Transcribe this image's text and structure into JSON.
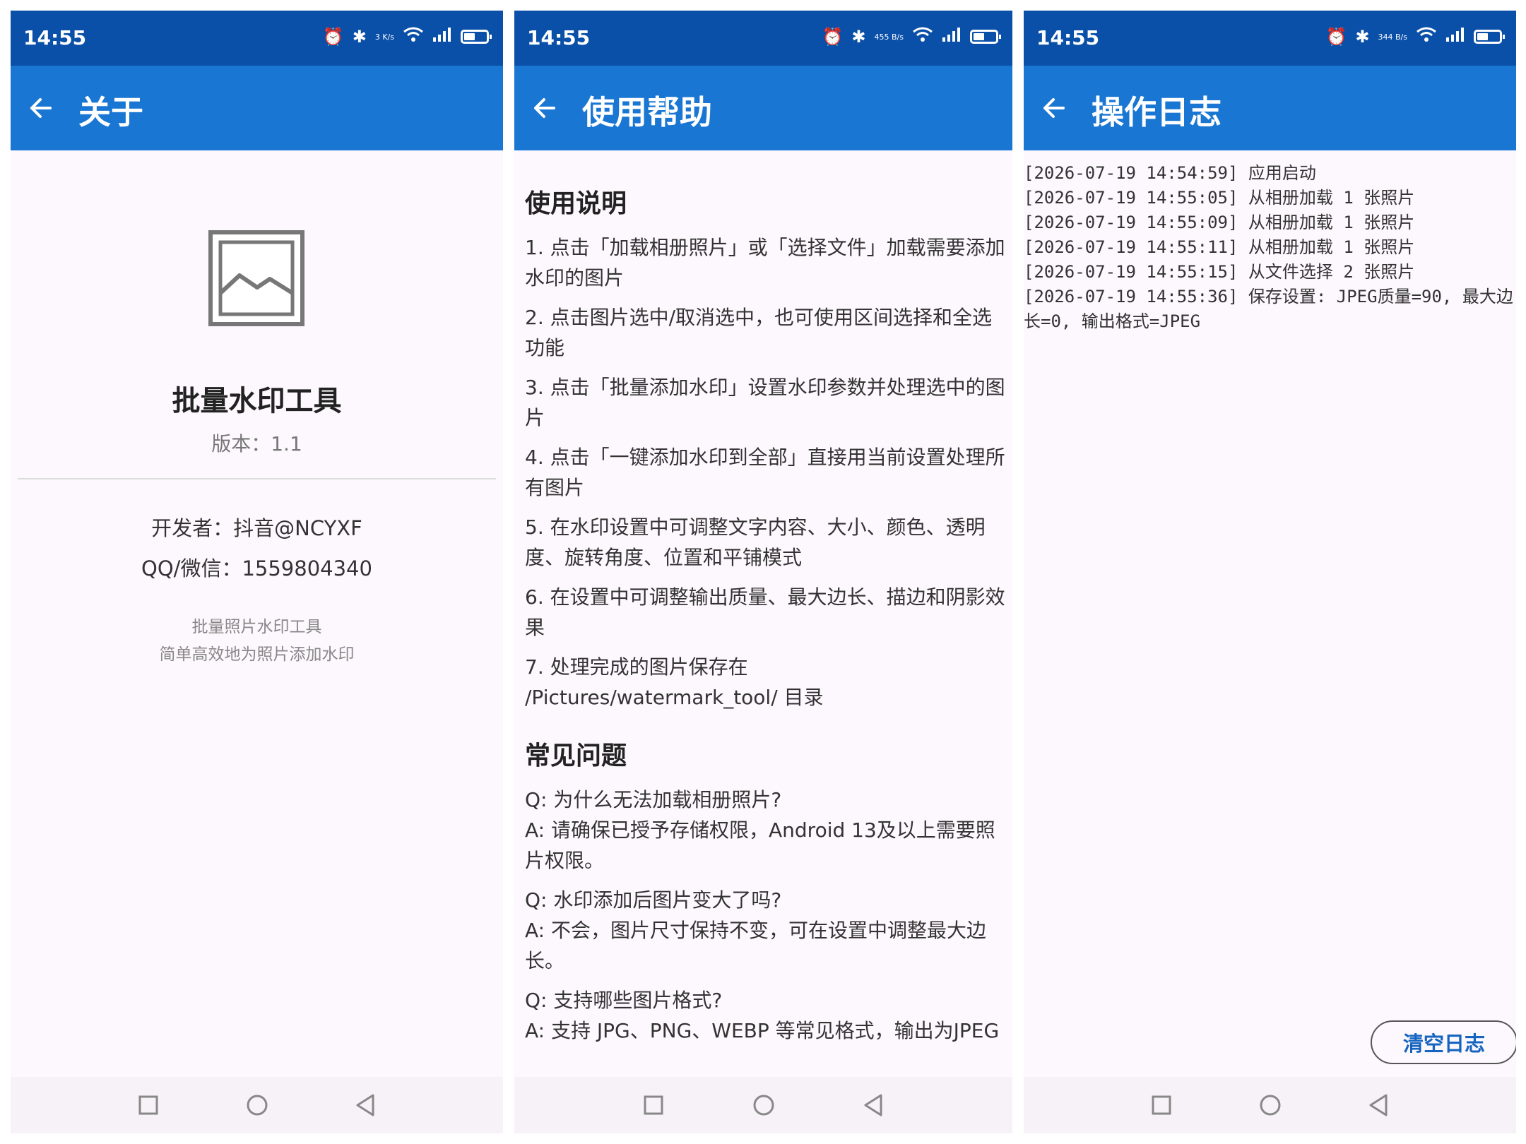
{
  "status": {
    "time": "14:55",
    "net_speeds": [
      "3 K/s",
      "455 B/s",
      "344 B/s"
    ]
  },
  "screen_about": {
    "title": "关于",
    "app_name": "批量水印工具",
    "version": "版本：1.1",
    "developer": "开发者：抖音@NCYXF",
    "contact": "QQ/微信：1559804340",
    "desc_line1": "批量照片水印工具",
    "desc_line2": "简单高效地为照片添加水印"
  },
  "screen_help": {
    "title": "使用帮助",
    "usage_heading": "使用说明",
    "usage": [
      "1. 点击「加载相册照片」或「选择文件」加载需要添加水印的图片",
      "2. 点击图片选中/取消选中，也可使用区间选择和全选功能",
      "3. 点击「批量添加水印」设置水印参数并处理选中的图片",
      "4. 点击「一键添加水印到全部」直接用当前设置处理所有图片",
      "5. 在水印设置中可调整文字内容、大小、颜色、透明度、旋转角度、位置和平铺模式",
      "6. 在设置中可调整输出质量、最大边长、描边和阴影效果",
      "7. 处理完成的图片保存在 /Pictures/watermark_tool/ 目录"
    ],
    "faq_heading": "常见问题",
    "faq": [
      {
        "q": "Q: 为什么无法加载相册照片?",
        "a": "A: 请确保已授予存储权限，Android 13及以上需要照片权限。"
      },
      {
        "q": "Q: 水印添加后图片变大了吗?",
        "a": "A: 不会，图片尺寸保持不变，可在设置中调整最大边长。"
      },
      {
        "q": "Q: 支持哪些图片格式?",
        "a": "A: 支持 JPG、PNG、WEBP 等常见格式，输出为JPEG"
      }
    ]
  },
  "screen_log": {
    "title": "操作日志",
    "entries": [
      "[2026-07-19 14:54:59] 应用启动",
      "[2026-07-19 14:55:05] 从相册加载 1 张照片",
      "[2026-07-19 14:55:09] 从相册加载 1 张照片",
      "[2026-07-19 14:55:11] 从相册加载 1 张照片",
      "[2026-07-19 14:55:15] 从文件选择 2 张照片",
      "[2026-07-19 14:55:36] 保存设置: JPEG质量=90, 最大边长=0, 输出格式=JPEG"
    ],
    "clear_button": "清空日志"
  },
  "colors": {
    "status_bar": "#0a50a8",
    "app_bar": "#1976d2",
    "background": "#fdf8fd",
    "accent_text": "#1565c0"
  },
  "icons": [
    "back-arrow-icon",
    "image-placeholder-icon",
    "alarm-icon",
    "bluetooth-icon",
    "wifi-icon",
    "signal-icon",
    "battery-icon",
    "nfc-icon",
    "nav-recents-icon",
    "nav-home-icon",
    "nav-back-icon"
  ]
}
